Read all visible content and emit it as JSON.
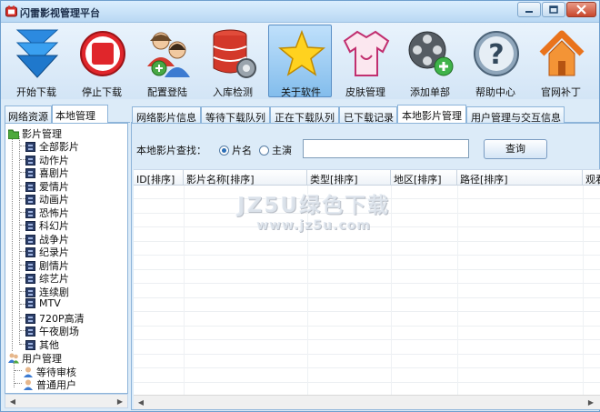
{
  "window": {
    "title": "闪雷影视管理平台",
    "icon": "app-logo-icon"
  },
  "toolbar": {
    "items": [
      {
        "label": "开始下载",
        "icon": "download-arrow-icon"
      },
      {
        "label": "停止下载",
        "icon": "stop-icon"
      },
      {
        "label": "配置登陆",
        "icon": "users-config-icon"
      },
      {
        "label": "入库检测",
        "icon": "database-gear-icon"
      },
      {
        "label": "关于软件",
        "icon": "star-icon"
      },
      {
        "label": "皮肤管理",
        "icon": "shirt-icon"
      },
      {
        "label": "添加单部",
        "icon": "film-reel-add-icon"
      },
      {
        "label": "帮助中心",
        "icon": "help-icon"
      },
      {
        "label": "官网补丁",
        "icon": "home-icon"
      }
    ],
    "active": "关于软件"
  },
  "left_panel": {
    "tabs": [
      "网络资源",
      "本地管理"
    ],
    "selected_tab": "本地管理",
    "tree": {
      "root_label": "影片管理",
      "categories": [
        "全部影片",
        "动作片",
        "喜剧片",
        "爱情片",
        "动画片",
        "恐怖片",
        "科幻片",
        "战争片",
        "纪录片",
        "剧情片",
        "综艺片",
        "连续剧",
        "MTV",
        "720P高清",
        "午夜剧场",
        "其他"
      ],
      "user_root_label": "用户管理",
      "user_items": [
        "等待审核",
        "普通用户"
      ]
    }
  },
  "right_panel": {
    "tabs": [
      "网络影片信息",
      "等待下载队列",
      "正在下载队列",
      "已下载记录",
      "本地影片管理",
      "用户管理与交互信息"
    ],
    "selected_tab": "本地影片管理",
    "search": {
      "label": "本地影片查找：",
      "options": [
        "片名",
        "主演"
      ],
      "selected_option": "片名",
      "value": "",
      "button_label": "查询"
    },
    "grid": {
      "columns": [
        "ID[排序]",
        "影片名称[排序]",
        "类型[排序]",
        "地区[排序]",
        "路径[排序]",
        "观看"
      ],
      "rows": []
    }
  },
  "watermark": {
    "main": "JZ5U绿色下载",
    "sub": "www.jz5u.com"
  },
  "colors": {
    "frame_bg": "#dcebf8",
    "accent": "#5a8fc6",
    "active_tool": "#9ccdf2"
  }
}
